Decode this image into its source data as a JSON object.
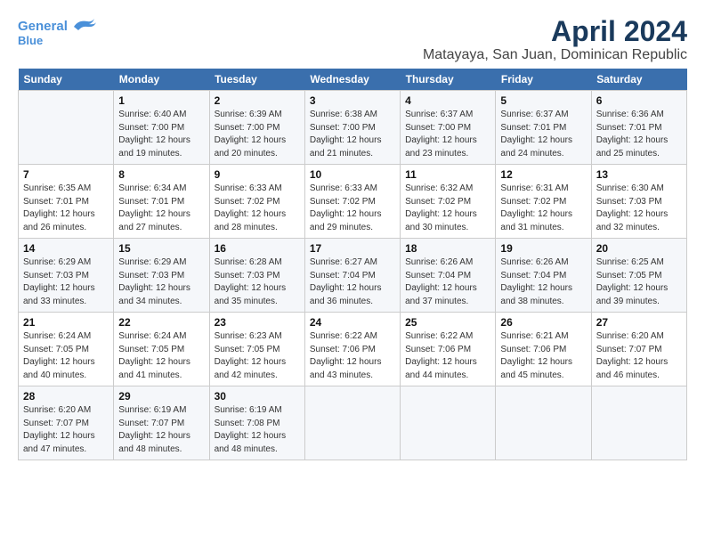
{
  "header": {
    "logo_line1": "General",
    "logo_line2": "Blue",
    "title": "April 2024",
    "subtitle": "Matayaya, San Juan, Dominican Republic"
  },
  "calendar": {
    "days_of_week": [
      "Sunday",
      "Monday",
      "Tuesday",
      "Wednesday",
      "Thursday",
      "Friday",
      "Saturday"
    ],
    "weeks": [
      [
        {
          "day": "",
          "info": ""
        },
        {
          "day": "1",
          "info": "Sunrise: 6:40 AM\nSunset: 7:00 PM\nDaylight: 12 hours\nand 19 minutes."
        },
        {
          "day": "2",
          "info": "Sunrise: 6:39 AM\nSunset: 7:00 PM\nDaylight: 12 hours\nand 20 minutes."
        },
        {
          "day": "3",
          "info": "Sunrise: 6:38 AM\nSunset: 7:00 PM\nDaylight: 12 hours\nand 21 minutes."
        },
        {
          "day": "4",
          "info": "Sunrise: 6:37 AM\nSunset: 7:00 PM\nDaylight: 12 hours\nand 23 minutes."
        },
        {
          "day": "5",
          "info": "Sunrise: 6:37 AM\nSunset: 7:01 PM\nDaylight: 12 hours\nand 24 minutes."
        },
        {
          "day": "6",
          "info": "Sunrise: 6:36 AM\nSunset: 7:01 PM\nDaylight: 12 hours\nand 25 minutes."
        }
      ],
      [
        {
          "day": "7",
          "info": "Sunrise: 6:35 AM\nSunset: 7:01 PM\nDaylight: 12 hours\nand 26 minutes."
        },
        {
          "day": "8",
          "info": "Sunrise: 6:34 AM\nSunset: 7:01 PM\nDaylight: 12 hours\nand 27 minutes."
        },
        {
          "day": "9",
          "info": "Sunrise: 6:33 AM\nSunset: 7:02 PM\nDaylight: 12 hours\nand 28 minutes."
        },
        {
          "day": "10",
          "info": "Sunrise: 6:33 AM\nSunset: 7:02 PM\nDaylight: 12 hours\nand 29 minutes."
        },
        {
          "day": "11",
          "info": "Sunrise: 6:32 AM\nSunset: 7:02 PM\nDaylight: 12 hours\nand 30 minutes."
        },
        {
          "day": "12",
          "info": "Sunrise: 6:31 AM\nSunset: 7:02 PM\nDaylight: 12 hours\nand 31 minutes."
        },
        {
          "day": "13",
          "info": "Sunrise: 6:30 AM\nSunset: 7:03 PM\nDaylight: 12 hours\nand 32 minutes."
        }
      ],
      [
        {
          "day": "14",
          "info": "Sunrise: 6:29 AM\nSunset: 7:03 PM\nDaylight: 12 hours\nand 33 minutes."
        },
        {
          "day": "15",
          "info": "Sunrise: 6:29 AM\nSunset: 7:03 PM\nDaylight: 12 hours\nand 34 minutes."
        },
        {
          "day": "16",
          "info": "Sunrise: 6:28 AM\nSunset: 7:03 PM\nDaylight: 12 hours\nand 35 minutes."
        },
        {
          "day": "17",
          "info": "Sunrise: 6:27 AM\nSunset: 7:04 PM\nDaylight: 12 hours\nand 36 minutes."
        },
        {
          "day": "18",
          "info": "Sunrise: 6:26 AM\nSunset: 7:04 PM\nDaylight: 12 hours\nand 37 minutes."
        },
        {
          "day": "19",
          "info": "Sunrise: 6:26 AM\nSunset: 7:04 PM\nDaylight: 12 hours\nand 38 minutes."
        },
        {
          "day": "20",
          "info": "Sunrise: 6:25 AM\nSunset: 7:05 PM\nDaylight: 12 hours\nand 39 minutes."
        }
      ],
      [
        {
          "day": "21",
          "info": "Sunrise: 6:24 AM\nSunset: 7:05 PM\nDaylight: 12 hours\nand 40 minutes."
        },
        {
          "day": "22",
          "info": "Sunrise: 6:24 AM\nSunset: 7:05 PM\nDaylight: 12 hours\nand 41 minutes."
        },
        {
          "day": "23",
          "info": "Sunrise: 6:23 AM\nSunset: 7:05 PM\nDaylight: 12 hours\nand 42 minutes."
        },
        {
          "day": "24",
          "info": "Sunrise: 6:22 AM\nSunset: 7:06 PM\nDaylight: 12 hours\nand 43 minutes."
        },
        {
          "day": "25",
          "info": "Sunrise: 6:22 AM\nSunset: 7:06 PM\nDaylight: 12 hours\nand 44 minutes."
        },
        {
          "day": "26",
          "info": "Sunrise: 6:21 AM\nSunset: 7:06 PM\nDaylight: 12 hours\nand 45 minutes."
        },
        {
          "day": "27",
          "info": "Sunrise: 6:20 AM\nSunset: 7:07 PM\nDaylight: 12 hours\nand 46 minutes."
        }
      ],
      [
        {
          "day": "28",
          "info": "Sunrise: 6:20 AM\nSunset: 7:07 PM\nDaylight: 12 hours\nand 47 minutes."
        },
        {
          "day": "29",
          "info": "Sunrise: 6:19 AM\nSunset: 7:07 PM\nDaylight: 12 hours\nand 48 minutes."
        },
        {
          "day": "30",
          "info": "Sunrise: 6:19 AM\nSunset: 7:08 PM\nDaylight: 12 hours\nand 48 minutes."
        },
        {
          "day": "",
          "info": ""
        },
        {
          "day": "",
          "info": ""
        },
        {
          "day": "",
          "info": ""
        },
        {
          "day": "",
          "info": ""
        }
      ]
    ]
  }
}
